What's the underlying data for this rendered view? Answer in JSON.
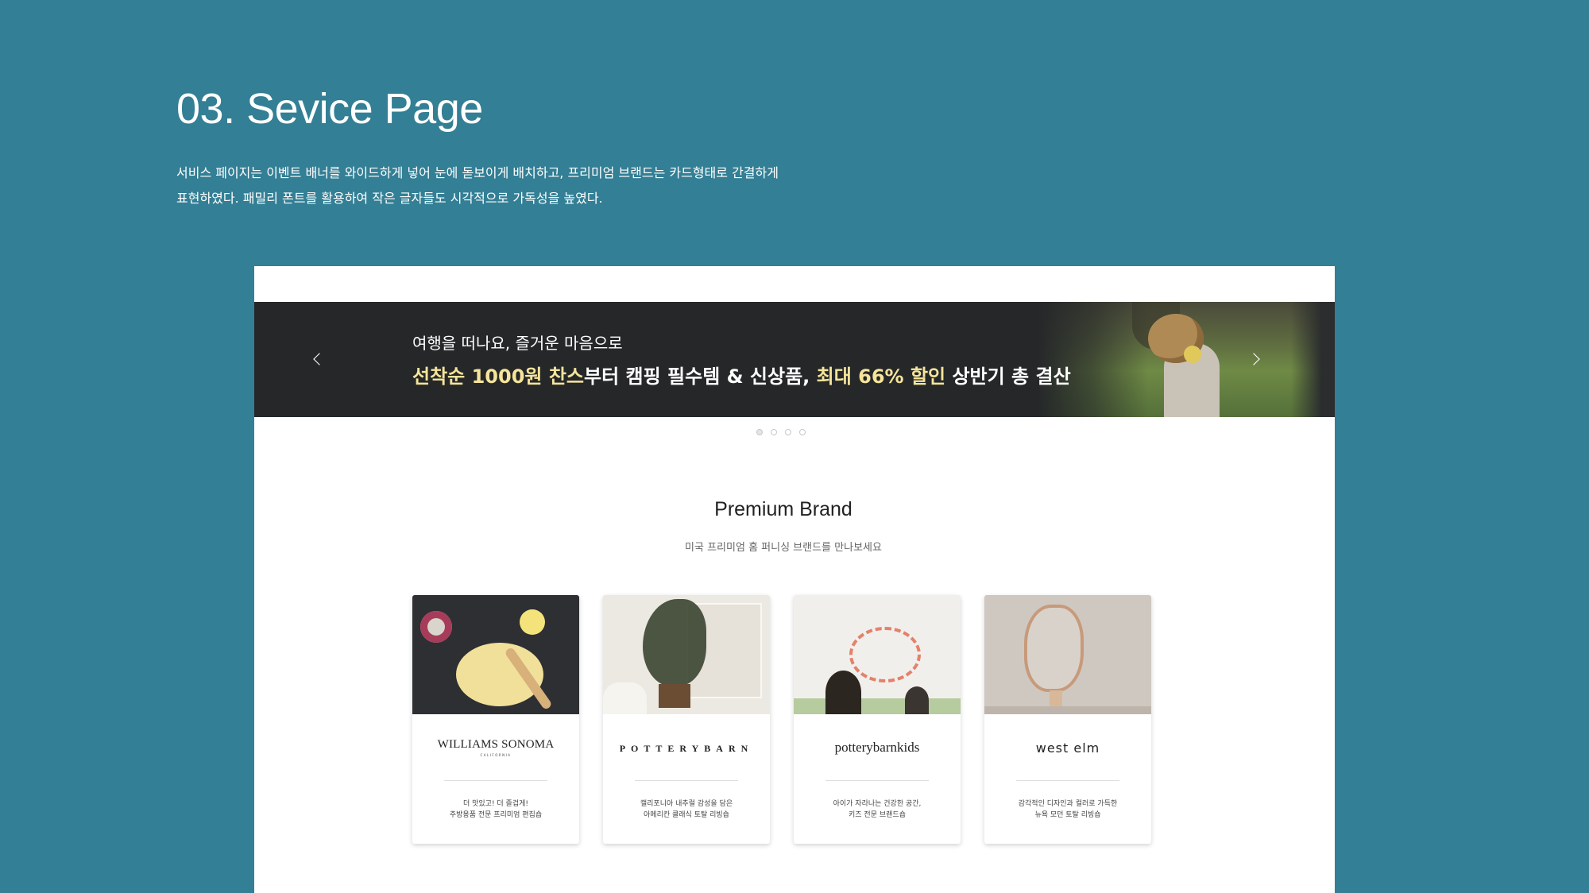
{
  "header": {
    "title": "03. Sevice Page",
    "description_line1": "서비스 페이지는 이벤트 배너를 와이드하게 넣어 눈에 돋보이게 배치하고, 프리미엄 브랜드는 카드형태로 간결하게",
    "description_line2": "표현하였다. 패밀리 폰트를 활용하여 작은 글자들도 시각적으로 가독성을 높였다."
  },
  "banner": {
    "subtitle": "여행을 떠나요, 즐거운 마음으로",
    "headline_prefix": "선착순 1000원 찬스",
    "headline_rest": "부터 캠핑 필수템 & 신상품, ",
    "headline_highlight2": "최대 66% 할인",
    "headline_suffix": " 상반기 총 결산",
    "slide_count": 4,
    "active_slide": 1
  },
  "premium": {
    "title": "Premium Brand",
    "subtitle": "미국 프리미엄 홈 퍼니싱 브랜드를 만나보세요"
  },
  "cards": [
    {
      "logo": "WILLIAMS SONOMA",
      "logo_sub": "CALIFORNIA",
      "desc_line1": "더 맛있고! 더 즐겁게!",
      "desc_line2": "주방용품 전문 프리미엄 편집숍"
    },
    {
      "logo": "POTTERYBARN",
      "desc_line1": "캘리포니아 내추럴 감성을 담은",
      "desc_line2": "아메리칸 클래식 토탈 리빙숍"
    },
    {
      "logo": "potterybarnkids",
      "desc_line1": "아이가 자라나는 건강한 공간,",
      "desc_line2": "키즈 전문 브랜드숍"
    },
    {
      "logo": "west elm",
      "desc_line1": "감각적인 디자인과 컬러로 가득한",
      "desc_line2": "뉴욕 모던 토탈 리빙숍"
    }
  ],
  "colors": {
    "background": "#337f95",
    "banner_bg": "#252729",
    "banner_highlight": "#f5e49a"
  }
}
